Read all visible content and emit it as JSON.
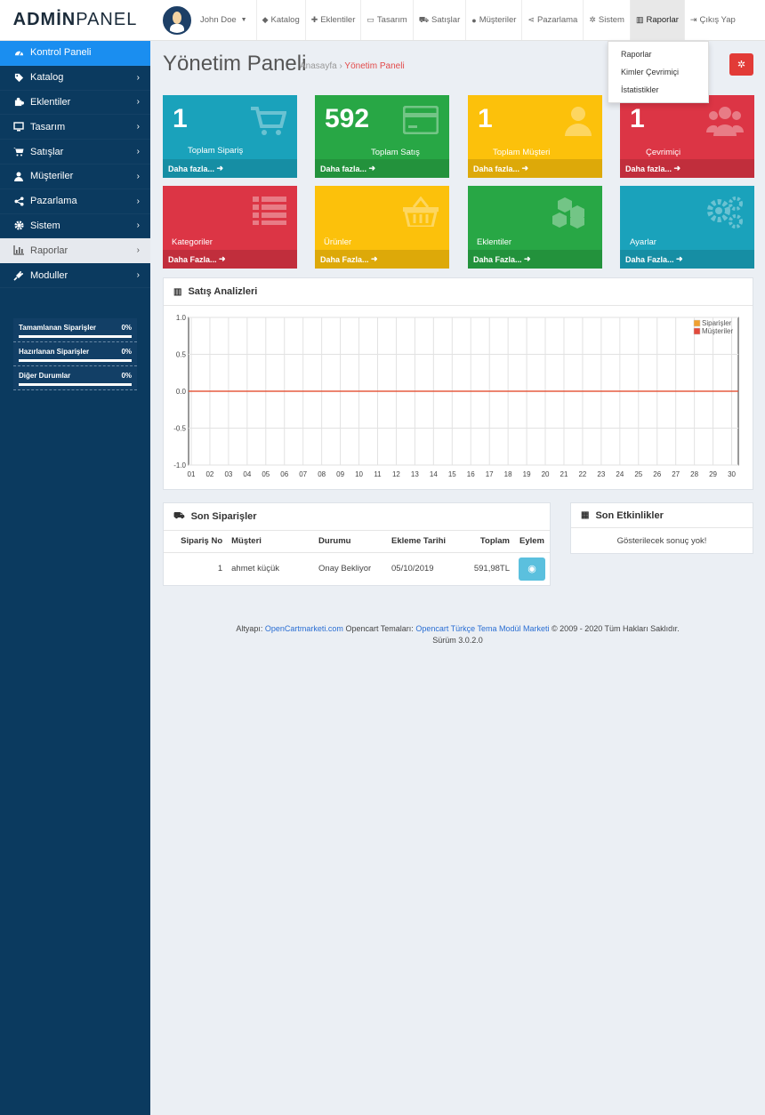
{
  "brand": {
    "part1": "ADMİN",
    "part2": " PANEL"
  },
  "sidebar": {
    "items": [
      {
        "label": "Kontrol Paneli",
        "icon": "dashboard-icon",
        "state": "active"
      },
      {
        "label": "Katalog",
        "icon": "tag-icon"
      },
      {
        "label": "Eklentiler",
        "icon": "puzzle-icon"
      },
      {
        "label": "Tasarım",
        "icon": "monitor-icon"
      },
      {
        "label": "Satışlar",
        "icon": "cart-icon"
      },
      {
        "label": "Müşteriler",
        "icon": "user-icon"
      },
      {
        "label": "Pazarlama",
        "icon": "share-icon"
      },
      {
        "label": "Sistem",
        "icon": "gear-icon"
      },
      {
        "label": "Raporlar",
        "icon": "bar-chart-icon",
        "state": "light"
      },
      {
        "label": "Moduller",
        "icon": "plug-icon"
      }
    ],
    "stats": [
      {
        "label": "Tamamlanan Siparişler",
        "value": "0%"
      },
      {
        "label": "Hazırlanan Siparişler",
        "value": "0%"
      },
      {
        "label": "Diğer Durumlar",
        "value": "0%"
      }
    ]
  },
  "header": {
    "user": "John Doe",
    "nav": [
      {
        "label": "Katalog",
        "icon": "tag-icon"
      },
      {
        "label": "Eklentiler",
        "icon": "puzzle-icon"
      },
      {
        "label": "Tasarım",
        "icon": "monitor-icon"
      },
      {
        "label": "Satışlar",
        "icon": "cart-icon"
      },
      {
        "label": "Müşteriler",
        "icon": "user-icon"
      },
      {
        "label": "Pazarlama",
        "icon": "share-icon"
      },
      {
        "label": "Sistem",
        "icon": "gear-icon"
      },
      {
        "label": "Raporlar",
        "icon": "bar-chart-icon"
      },
      {
        "label": "Çıkış Yap",
        "icon": "logout-icon"
      }
    ]
  },
  "dropdown": [
    "Raporlar",
    "Kimler Çevrimiçi",
    "İstatistikler"
  ],
  "page": {
    "title": "Yönetim Paneli",
    "crumb_home": "Anasayfa",
    "crumb_current": "Yönetim Paneli"
  },
  "tiles": [
    {
      "num": "1",
      "label": "Toplam Sipariş",
      "more": "Daha fazla...",
      "color": "#1aa2bb"
    },
    {
      "num": "592",
      "label": "Toplam Satış",
      "more": "Daha fazla...",
      "color": "#28a745"
    },
    {
      "num": "1",
      "label": "Toplam Müşteri",
      "more": "Daha fazla...",
      "color": "#fcc10b"
    },
    {
      "num": "1",
      "label": "Çevrimiçi",
      "more": "Daha fazla...",
      "color": "#dc3545"
    },
    {
      "label": "Kategoriler",
      "more": "Daha Fazla...",
      "color": "#dc3545"
    },
    {
      "label": "Ürünler",
      "more": "Daha Fazla...",
      "color": "#fcc10b"
    },
    {
      "label": "Eklentiler",
      "more": "Daha Fazla...",
      "color": "#28a745"
    },
    {
      "label": "Ayarlar",
      "more": "Daha Fazla...",
      "color": "#1aa2bb"
    }
  ],
  "analytics": {
    "title": "Satış Analizleri"
  },
  "chart_data": {
    "type": "line",
    "x": [
      "01",
      "02",
      "03",
      "04",
      "05",
      "06",
      "07",
      "08",
      "09",
      "10",
      "11",
      "12",
      "13",
      "14",
      "15",
      "16",
      "17",
      "18",
      "19",
      "20",
      "21",
      "22",
      "23",
      "24",
      "25",
      "26",
      "27",
      "28",
      "29",
      "30"
    ],
    "series": [
      {
        "name": "Siparişler",
        "color": "#f0a030",
        "values": [
          0,
          0,
          0,
          0,
          0,
          0,
          0,
          0,
          0,
          0,
          0,
          0,
          0,
          0,
          0,
          0,
          0,
          0,
          0,
          0,
          0,
          0,
          0,
          0,
          0,
          0,
          0,
          0,
          0,
          0
        ]
      },
      {
        "name": "Müşteriler",
        "color": "#e24a3b",
        "values": [
          0,
          0,
          0,
          0,
          0,
          0,
          0,
          0,
          0,
          0,
          0,
          0,
          0,
          0,
          0,
          0,
          0,
          0,
          0,
          0,
          0,
          0,
          0,
          0,
          0,
          0,
          0,
          0,
          0,
          0
        ]
      }
    ],
    "yticks": [
      "1.0",
      "0.5",
      "0.0",
      "-0.5",
      "-1.0"
    ],
    "ylim": [
      -1,
      1
    ],
    "legend": "top-right",
    "grid": true
  },
  "orders": {
    "title": "Son Siparişler",
    "columns": [
      "Sipariş No",
      "Müşteri",
      "Durumu",
      "Ekleme Tarihi",
      "Toplam",
      "Eylem"
    ],
    "rows": [
      {
        "id": "1",
        "customer": "ahmet küçük",
        "status": "Onay Bekliyor",
        "date": "05/10/2019",
        "total": "591,98TL"
      }
    ]
  },
  "activity": {
    "title": "Son Etkinlikler",
    "empty": "Gösterilecek sonuç yok!"
  },
  "footer": {
    "a": "Altyapı: ",
    "l1": "OpenCartmarketi.com",
    "b": " Opencart Temaları: ",
    "l2": "Opencart Türkçe Tema Modül Marketi",
    "c": " © 2009 - 2020 Tüm Hakları Saklıdır.",
    "version": "Sürüm 3.0.2.0"
  }
}
